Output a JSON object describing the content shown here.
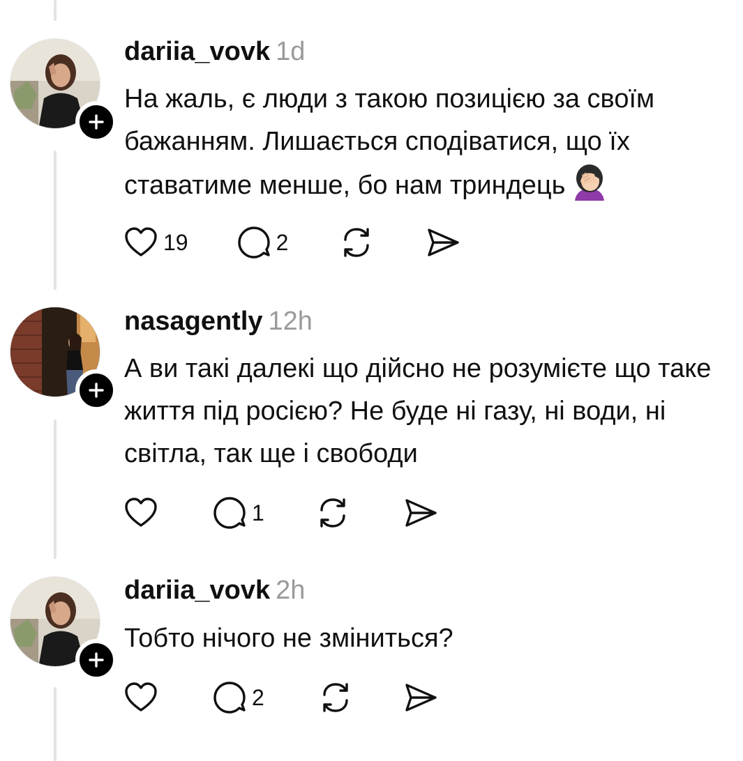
{
  "posts": [
    {
      "username": "dariia_vovk",
      "time": "1d",
      "text": "На жаль, є люди з такою позицією за своїм бажанням. Лишається сподіватися, що їх ставатиме менше, бо нам триндець",
      "emoji": "face-palm-emoji",
      "likes": "19",
      "replies": "2",
      "avatar": "avatar-photo"
    },
    {
      "username": "nasagently",
      "time": "12h",
      "text": "А ви такі далекі що дійсно не розумієте що таке життя під росією? Не буде ні газу, ні води, ні світла, так ще і свободи",
      "likes": "",
      "replies": "1",
      "avatar": "avatar-photo"
    },
    {
      "username": "dariia_vovk",
      "time": "2h",
      "text": "Тобто нічого не зміниться?",
      "likes": "",
      "replies": "2",
      "avatar": "avatar-photo"
    }
  ],
  "icons": {
    "like": "heart-icon",
    "reply": "comment-icon",
    "repost": "repost-icon",
    "share": "send-icon",
    "follow": "plus-icon"
  },
  "colors": {
    "text": "#101010",
    "muted": "#9a9a9a",
    "thread_line": "#e3e3e3",
    "badge": "#000000"
  }
}
